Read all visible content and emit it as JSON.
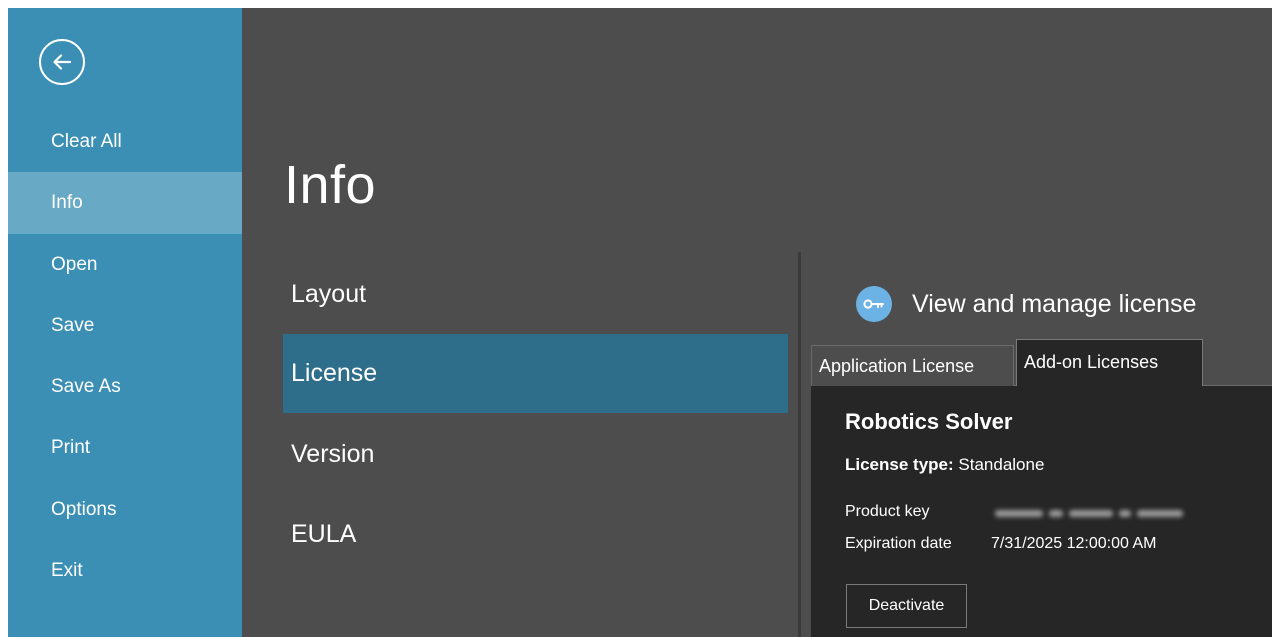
{
  "sidebar": {
    "back_icon": "back-arrow-circle-icon",
    "items": [
      {
        "label": "Clear All",
        "active": false
      },
      {
        "label": "Info",
        "active": true
      },
      {
        "label": "Open",
        "active": false
      },
      {
        "label": "Save",
        "active": false
      },
      {
        "label": "Save As",
        "active": false
      },
      {
        "label": "Print",
        "active": false
      },
      {
        "label": "Options",
        "active": false
      },
      {
        "label": "Exit",
        "active": false
      }
    ]
  },
  "main": {
    "title": "Info",
    "sections": [
      {
        "label": "Layout",
        "active": false
      },
      {
        "label": "License",
        "active": true
      },
      {
        "label": "Version",
        "active": false
      },
      {
        "label": "EULA",
        "active": false
      }
    ]
  },
  "license_panel": {
    "icon": "key-icon",
    "header": "View and manage license",
    "tabs": [
      {
        "label": "Application License",
        "active": false
      },
      {
        "label": "Add-on Licenses",
        "active": true
      }
    ],
    "product_name": "Robotics Solver",
    "license_type_label": "License type:",
    "license_type_value": "Standalone",
    "product_key_label": "Product key",
    "expiration_label": "Expiration date",
    "expiration_value": "7/31/2025 12:00:00 AM",
    "deactivate_label": "Deactivate"
  },
  "colors": {
    "sidebar_bg": "#3b8fb4",
    "sidebar_active": "#68a9c6",
    "content_bg": "#4d4d4d",
    "section_active": "#2e6e8a",
    "card_bg": "#262626",
    "key_badge": "#6cb2e4"
  }
}
